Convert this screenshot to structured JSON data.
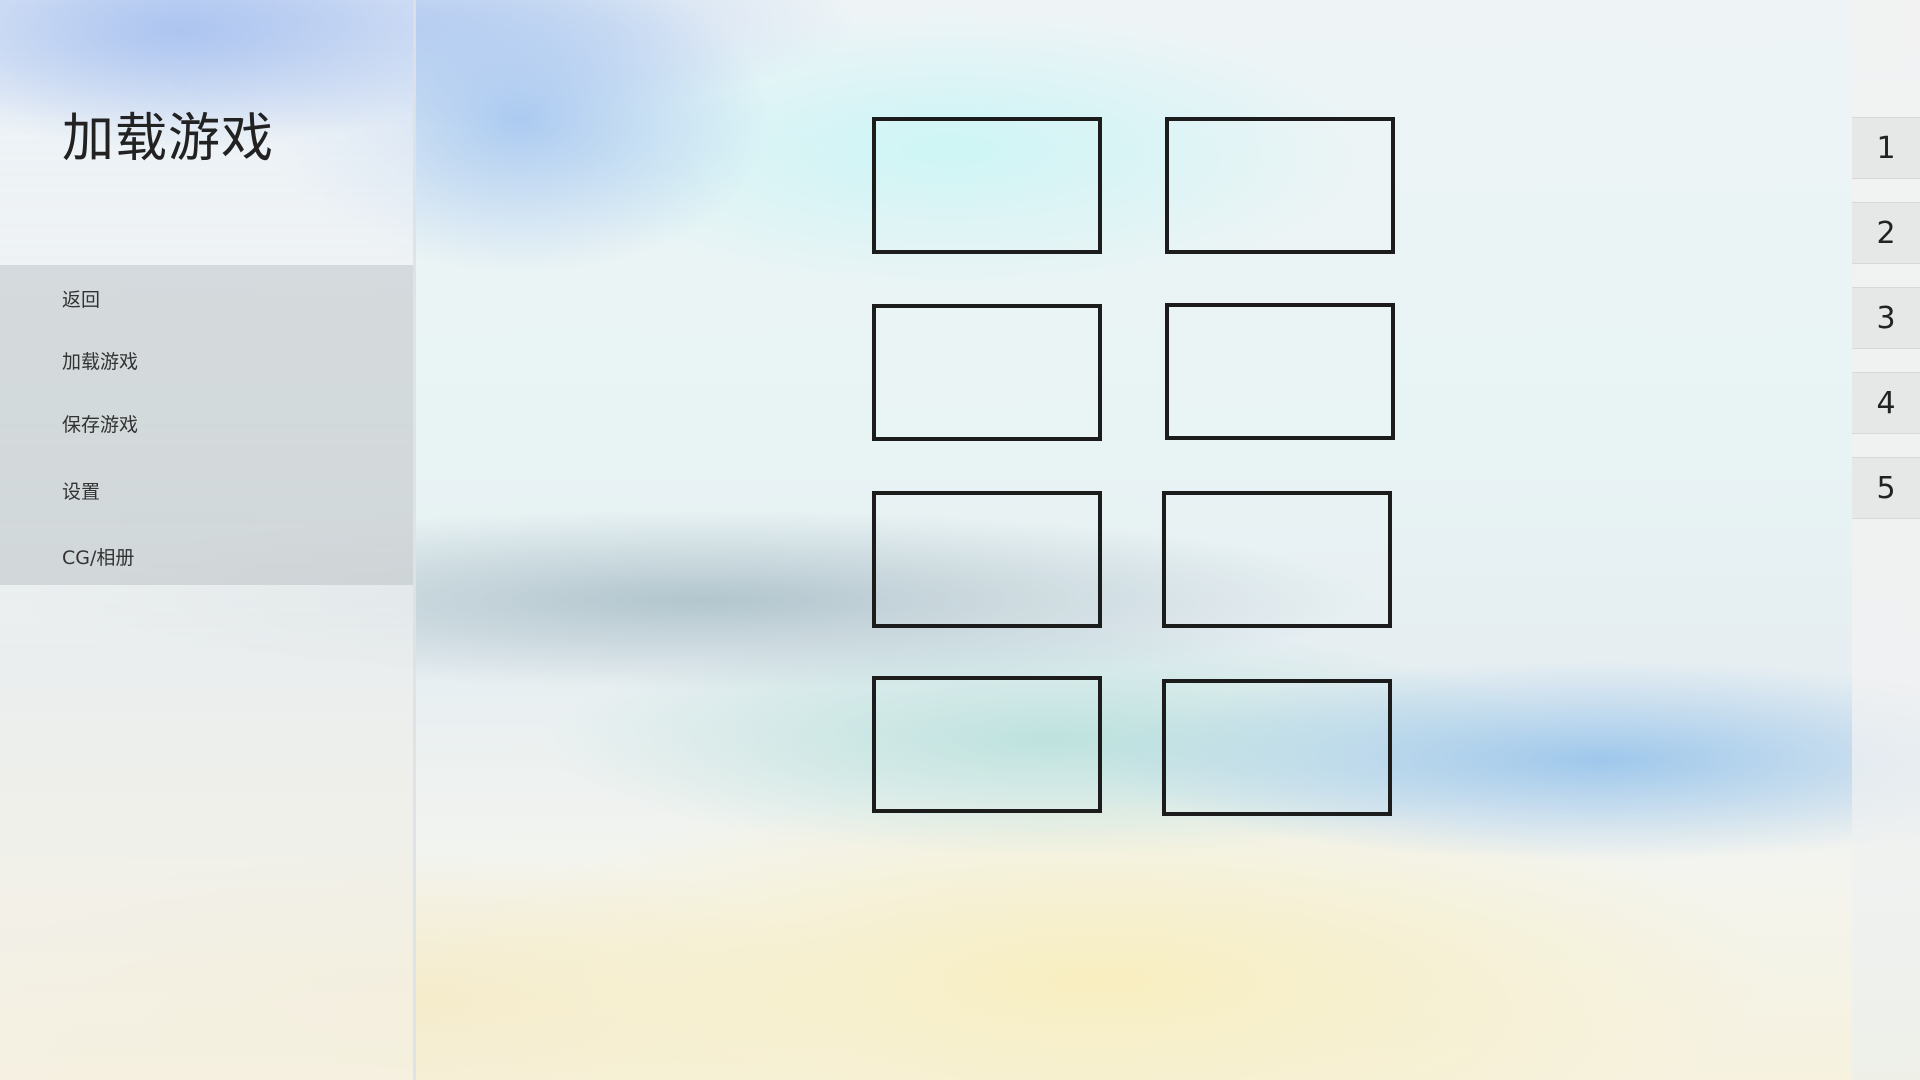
{
  "screen": {
    "title": "加载游戏"
  },
  "menu": {
    "items": [
      {
        "label": "返回"
      },
      {
        "label": "加载游戏"
      },
      {
        "label": "保存游戏"
      },
      {
        "label": "设置"
      },
      {
        "label": "CG/相册"
      }
    ]
  },
  "pagination": {
    "pages": [
      "1",
      "2",
      "3",
      "4",
      "5"
    ]
  },
  "colors": {
    "slot_border": "#1c1c1c",
    "page_tab_bg": "#e6e7e7",
    "text": "#222222"
  }
}
